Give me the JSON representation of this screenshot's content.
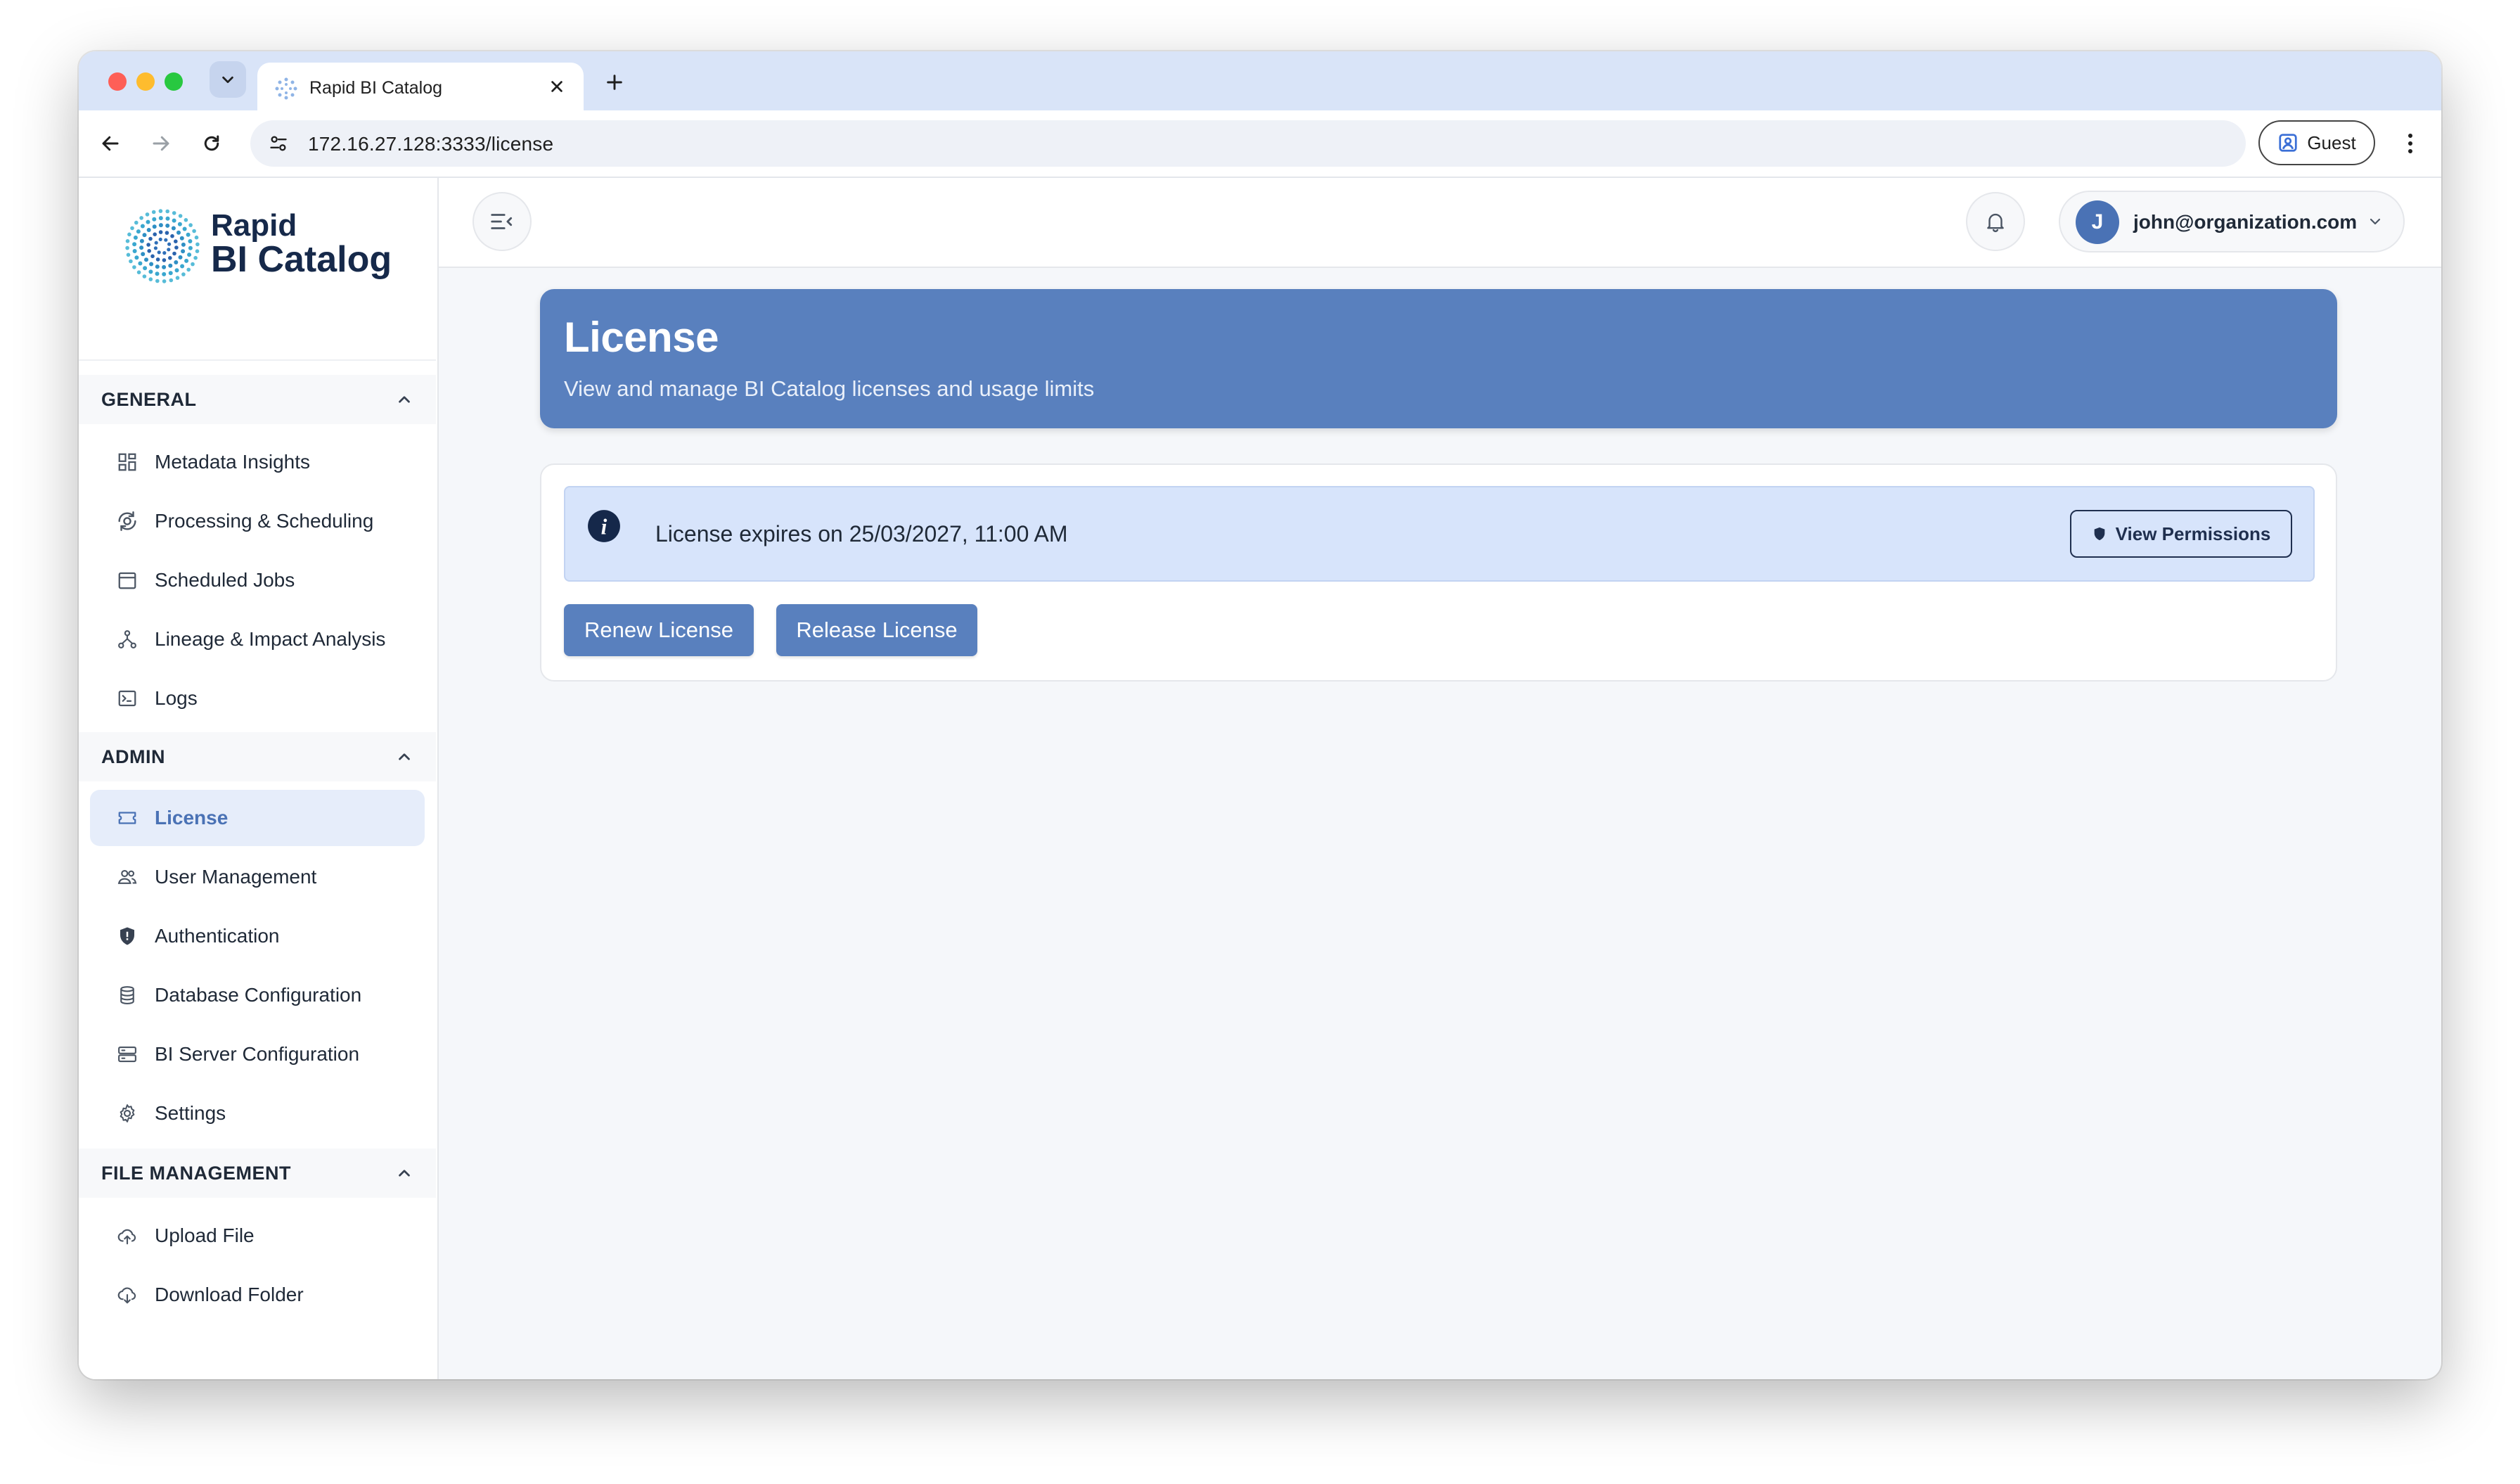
{
  "browser": {
    "tab_title": "Rapid BI Catalog",
    "url": "172.16.27.128:3333/license",
    "profile_label": "Guest"
  },
  "brand": {
    "line1": "Rapid",
    "line2": "BI Catalog",
    "accent_color": "#5980be",
    "text_color": "#16294a"
  },
  "sidebar": {
    "sections": [
      {
        "title": "GENERAL",
        "items": [
          {
            "label": "Metadata Insights",
            "icon": "grid-icon"
          },
          {
            "label": "Processing & Scheduling",
            "icon": "refresh-gear-icon"
          },
          {
            "label": "Scheduled Jobs",
            "icon": "calendar-icon"
          },
          {
            "label": "Lineage & Impact Analysis",
            "icon": "lineage-icon"
          },
          {
            "label": "Logs",
            "icon": "terminal-icon"
          }
        ]
      },
      {
        "title": "ADMIN",
        "items": [
          {
            "label": "License",
            "icon": "ticket-icon",
            "active": true
          },
          {
            "label": "User Management",
            "icon": "users-icon"
          },
          {
            "label": "Authentication",
            "icon": "shield-icon"
          },
          {
            "label": "Database Configuration",
            "icon": "database-icon"
          },
          {
            "label": "BI Server Configuration",
            "icon": "server-icon"
          },
          {
            "label": "Settings",
            "icon": "gear-icon"
          }
        ]
      },
      {
        "title": "FILE MANAGEMENT",
        "items": [
          {
            "label": "Upload File",
            "icon": "cloud-upload-icon"
          },
          {
            "label": "Download Folder",
            "icon": "cloud-download-icon"
          }
        ]
      }
    ]
  },
  "header": {
    "user_initial": "J",
    "user_email": "john@organization.com"
  },
  "page": {
    "title": "License",
    "subtitle": "View and manage BI Catalog licenses and usage limits",
    "alert_text": "License expires on 25/03/2027, 11:00 AM",
    "view_permissions_label": "View Permissions",
    "renew_label": "Renew License",
    "release_label": "Release License"
  }
}
